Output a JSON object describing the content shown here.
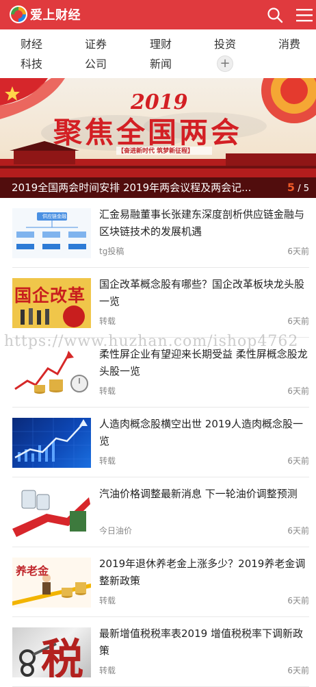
{
  "header": {
    "logo_text": "爱上财经",
    "brand_color": "#e03a3e",
    "icons": [
      "logo-icon",
      "search-icon",
      "menu-icon"
    ]
  },
  "nav": {
    "items": [
      "财经",
      "证券",
      "理财",
      "投资",
      "消费",
      "科技",
      "公司",
      "新闻"
    ],
    "more_symbol": "+"
  },
  "banner": {
    "year": "2019",
    "slogan": "聚焦全国两会",
    "subtitle": "【奋进新时代  筑梦新征程】",
    "caption": "2019全国两会时间安排 2019年两会议程及两会记...",
    "page_current": "5",
    "page_total": "/ 5"
  },
  "articles": [
    {
      "title": "汇金易融董事长张建东深度剖析供应链金融与区块链技术的发展机遇",
      "source": "tg投稿",
      "time": "6天前",
      "thumb": "flowchart",
      "thumb_label": "供应链金融"
    },
    {
      "title": "国企改革概念股有哪些？国企改革板块龙头股一览",
      "source": "转载",
      "time": "6天前",
      "thumb": "soe-reform",
      "thumb_label": "国企改革"
    },
    {
      "title": "柔性屏企业有望迎来长期受益 柔性屏概念股龙头股一览",
      "source": "转载",
      "time": "6天前",
      "thumb": "coins-chart",
      "thumb_label": ""
    },
    {
      "title": "人造肉概念股横空出世 2019人造肉概念股一览",
      "source": "转载",
      "time": "6天前",
      "thumb": "blue-chart",
      "thumb_label": ""
    },
    {
      "title": "汽油价格调整最新消息 下一轮油价调整预测",
      "source": "今日油价",
      "time": "6天前",
      "thumb": "oil-barrels",
      "thumb_label": ""
    },
    {
      "title": "2019年退休养老金上涨多少？2019养老金调整新政策",
      "source": "转载",
      "time": "6天前",
      "thumb": "pension",
      "thumb_label": "养老金"
    },
    {
      "title": "最新增值税税率表2019 增值税税率下调新政策",
      "source": "转载",
      "time": "6天前",
      "thumb": "tax",
      "thumb_label": "税"
    }
  ],
  "watermark": "https://www.huzhan.com/ishop4762"
}
